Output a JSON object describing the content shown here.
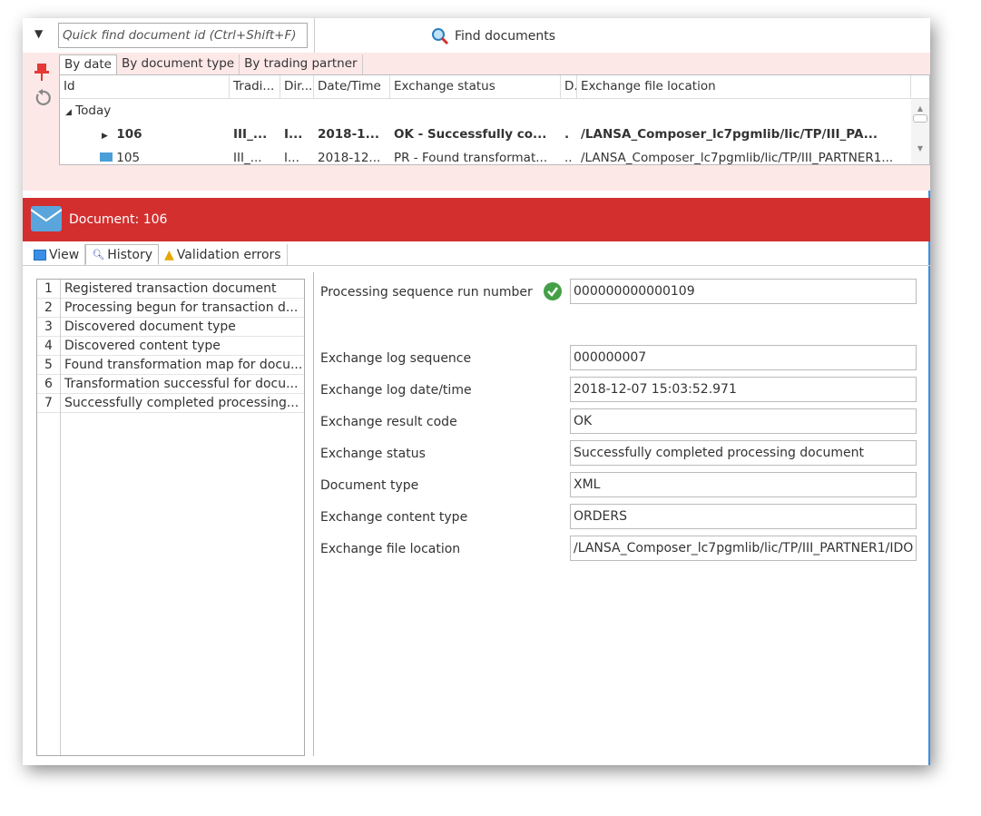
{
  "toolbar": {
    "quick_find_placeholder": "Quick find document id (Ctrl+Shift+F)",
    "find_label": "Find documents"
  },
  "browse_tabs": [
    "By date",
    "By document type",
    "By trading partner"
  ],
  "grid": {
    "columns": [
      "Id",
      "Tradi...",
      "Dir...",
      "Date/Time",
      "Exchange status",
      "D.",
      "Exchange file location"
    ],
    "group": "Today",
    "rows": [
      {
        "id": "106",
        "trading": "III_...",
        "dir": "I...",
        "datetime": "2018-1...",
        "status": "OK - Successfully co...",
        "d": ".",
        "location": "/LANSA_Composer_lc7pgmlib/lic/TP/III_PA...",
        "bold": true
      },
      {
        "id": "105",
        "trading": "III_...",
        "dir": "I...",
        "datetime": "2018-12...",
        "status": "PR - Found transformat...",
        "d": "..",
        "location": "/LANSA_Composer_lc7pgmlib/lic/TP/III_PARTNER1..."
      }
    ]
  },
  "document": {
    "title": "Document: 106"
  },
  "detail_tabs": [
    "View",
    "History",
    "Validation errors"
  ],
  "history": [
    {
      "n": "1",
      "text": "Registered transaction document"
    },
    {
      "n": "2",
      "text": "Processing begun for transaction d..."
    },
    {
      "n": "3",
      "text": "Discovered document type"
    },
    {
      "n": "4",
      "text": "Discovered content type"
    },
    {
      "n": "5",
      "text": "Found transformation map for docu..."
    },
    {
      "n": "6",
      "text": "Transformation successful for docu..."
    },
    {
      "n": "7",
      "text": "Successfully completed processing..."
    }
  ],
  "fields": {
    "run_number": {
      "label": "Processing sequence run number",
      "value": "000000000000109"
    },
    "items": [
      {
        "label": "Exchange log sequence",
        "value": "000000007"
      },
      {
        "label": "Exchange log date/time",
        "value": "2018-12-07 15:03:52.971"
      },
      {
        "label": "Exchange result code",
        "value": "OK"
      },
      {
        "label": "Exchange status",
        "value": "Successfully completed processing document"
      },
      {
        "label": "Document type",
        "value": "XML"
      },
      {
        "label": "Exchange content type",
        "value": "ORDERS"
      },
      {
        "label": "Exchange file location",
        "value": "/LANSA_Composer_lc7pgmlib/lic/TP/III_PARTNER1/IDO"
      }
    ]
  },
  "colors": {
    "header_red": "#d32f2f",
    "pink": "#fde8e8",
    "accent_blue": "#3a8ee6"
  }
}
